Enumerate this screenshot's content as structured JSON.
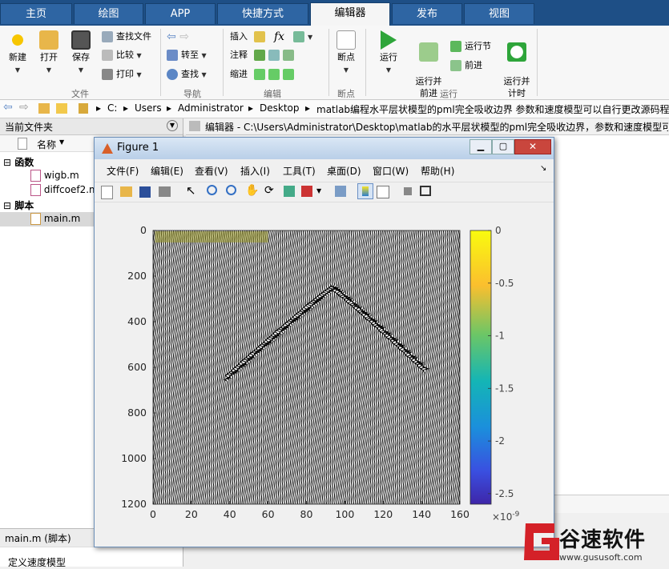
{
  "tabs": [
    "主页",
    "绘图",
    "APP",
    "快捷方式",
    "编辑器",
    "发布",
    "视图"
  ],
  "active_tab": "编辑器",
  "ribbon": {
    "file": {
      "new": "新建",
      "open": "打开",
      "save": "保存",
      "find_files": "查找文件",
      "compare": "比较",
      "print": "打印",
      "group": "文件"
    },
    "nav": {
      "goto": "转至",
      "find": "查找",
      "group": "导航"
    },
    "edit": {
      "insert": "插入",
      "comment": "注释",
      "indent": "缩进",
      "fx": "fx",
      "group": "编辑"
    },
    "breakpoints": {
      "label": "断点",
      "group": "断点"
    },
    "run": {
      "run": "运行",
      "run_advance": "运行并\n前进",
      "run_section": "运行节",
      "advance": "前进",
      "run_time": "运行并\n计时",
      "group": "运行"
    }
  },
  "address": {
    "parts": [
      "C:",
      "Users",
      "Administrator",
      "Desktop",
      "matlab编程水平层状模型的pml完全吸收边界 参数和速度模型可以自行更改源码程序"
    ]
  },
  "left_panel": {
    "title": "当前文件夹",
    "column": "名称",
    "groups": [
      {
        "label": "函数",
        "files": [
          "wigb.m",
          "diffcoef2.m"
        ]
      },
      {
        "label": "脚本",
        "files": [
          "main.m"
        ]
      }
    ],
    "details_title": "main.m  (脚本)",
    "description": "定义速度模型"
  },
  "editor": {
    "title": "编辑器 - C:\\Users\\Administrator\\Desktop\\matlab的水平层状模型的pml完全吸收边界，参数和速度模型可"
  },
  "figure": {
    "title": "Figure 1",
    "menu": [
      "文件(F)",
      "编辑(E)",
      "查看(V)",
      "插入(I)",
      "工具(T)",
      "桌面(D)",
      "窗口(W)",
      "帮助(H)"
    ],
    "toolbar_icons": [
      "new-figure-icon",
      "open-file-icon",
      "save-icon",
      "print-icon",
      "pointer-icon",
      "zoom-in-icon",
      "zoom-out-icon",
      "pan-icon",
      "rotate-icon",
      "data-cursor-icon",
      "brush-icon",
      "link-icon",
      "colorbar-icon",
      "legend-icon",
      "hide-tools-icon",
      "dock-icon"
    ]
  },
  "chart_data": {
    "type": "heatmap",
    "title": "",
    "xlabel": "",
    "ylabel": "",
    "x_ticks": [
      0,
      20,
      40,
      60,
      80,
      100,
      120,
      140,
      160
    ],
    "y_ticks": [
      0,
      200,
      400,
      600,
      800,
      1000,
      1200
    ],
    "xlim": [
      0,
      160
    ],
    "ylim": [
      1200,
      0
    ],
    "colorbar": {
      "ticks": [
        "0",
        "-0.5",
        "-1",
        "-1.5",
        "-2",
        "-2.5"
      ],
      "exponent": "×10",
      "exponent_power": "-9",
      "colormap": "parula"
    },
    "traces": 160,
    "event_apex": {
      "x": 94,
      "y": 250
    },
    "event_left_end": {
      "x": 38,
      "y": 650
    },
    "event_right_end": {
      "x": 142,
      "y": 610
    },
    "trace_color": "#000000"
  },
  "watermark": {
    "brand": "谷速软件",
    "url": "www.gususoft.com",
    "color": "#d42128"
  }
}
